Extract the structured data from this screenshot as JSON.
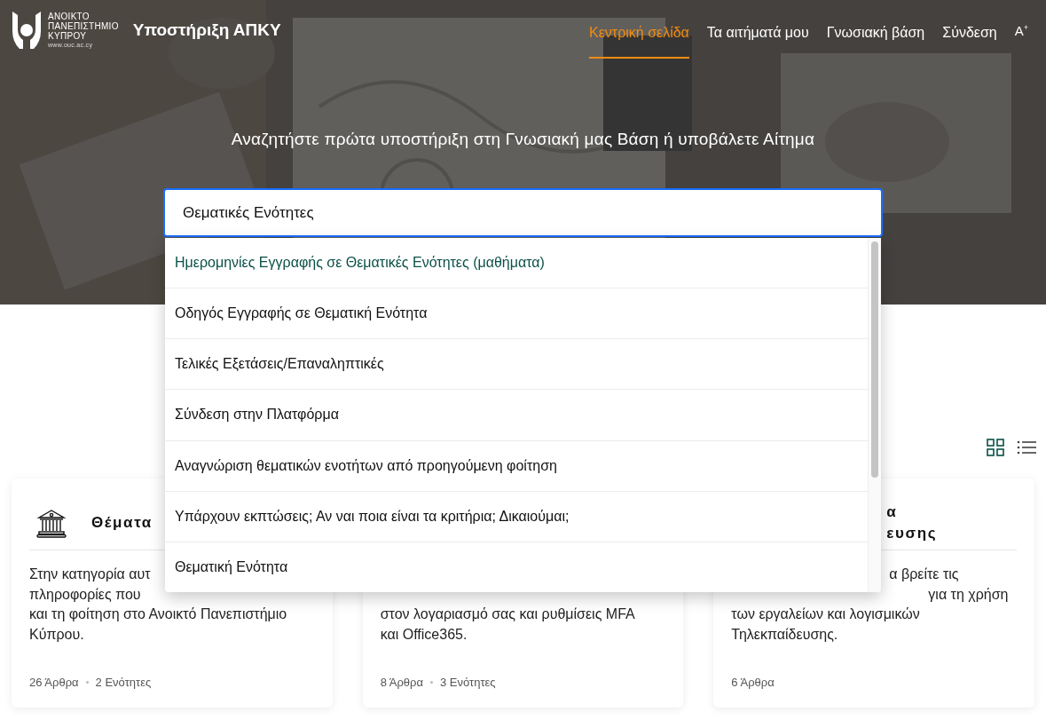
{
  "header": {
    "logo_lines": [
      "ΑΝΟΙΚΤΟ",
      "ΠΑΝΕΠΙΣΤΗΜΙΟ",
      "ΚΥΠΡΟΥ"
    ],
    "logo_url": "www.ouc.ac.cy",
    "site_title": "Υποστήριξη ΑΠΚΥ",
    "nav": [
      {
        "label": "Κεντρική σελίδα",
        "selected": true
      },
      {
        "label": "Τα αιτήματά μου",
        "selected": false
      },
      {
        "label": "Γνωσιακή βάση",
        "selected": false
      },
      {
        "label": "Σύνδεση",
        "selected": false
      }
    ],
    "font_size_button": "A$^{+}$"
  },
  "hero": {
    "heading": "Αναζητήστε πρώτα υποστήριξη στη Γνωσιακή μας Βάση ή υποβάλετε Αίτημα"
  },
  "search": {
    "value": "Θεματικές Ενότητες",
    "suggestions": [
      {
        "label": "Ημερομηνίες Εγγραφής σε Θεματικές Ενότητες (μαθήματα)",
        "selected": true
      },
      {
        "label": "Οδηγός Εγγραφής σε Θεματική Ενότητα",
        "selected": false
      },
      {
        "label": "Τελικές Εξετάσεις/Επαναληπτικές",
        "selected": false
      },
      {
        "label": "Σύνδεση στην Πλατφόρμα",
        "selected": false
      },
      {
        "label": "Αναγνώριση θεματικών ενοτήτων από προηγούμενη φοίτηση",
        "selected": false
      },
      {
        "label": "Υπάρχουν εκπτώσεις; Αν ναι ποια είναι τα κριτήρια; Δικαιούμαι;",
        "selected": false
      },
      {
        "label": "Θεματική Ενότητα",
        "selected": false
      }
    ]
  },
  "view_toggle": [
    {
      "kind": "grid",
      "selected": true
    },
    {
      "kind": "list",
      "selected": false
    }
  ],
  "categories": [
    {
      "title_lines": [
        "Θέματα"
      ],
      "description_lines": [
        "Στην κατηγορία αυτ",
        "πληροφορίες που",
        "και τη φοίτηση στο Ανοικτό Πανεπιστήμιο",
        "Κύπρου."
      ],
      "stats": [
        "26 Άρθρα",
        "2 Ενότητες"
      ]
    },
    {
      "description_lines": [
        "στον λογαριασμό σας και ρυθμίσεις MFA",
        "και Office365."
      ],
      "stats": [
        "8 Άρθρα",
        "3 Ενότητες"
      ]
    },
    {
      "title_lines": [
        "α",
        "ευσης"
      ],
      "description_lines": [
        "α βρείτε τις",
        "για τη χρήση",
        "των εργαλείων και λογισμικών",
        "Τηλεκπαίδευσης."
      ],
      "stats": [
        "6 Άρθρα"
      ]
    }
  ]
}
